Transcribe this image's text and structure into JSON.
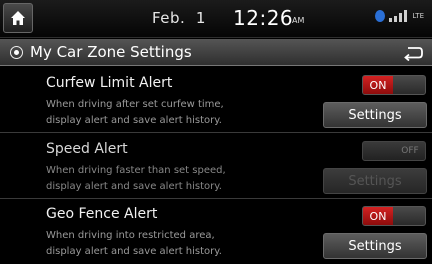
{
  "status_bar": {
    "date": "Feb.  1",
    "time": "12:26",
    "ampm": "AM",
    "network": "LTE",
    "icons": [
      "home-icon",
      "bluetooth-icon",
      "signal-icon"
    ]
  },
  "title_bar": {
    "title": "My Car Zone Settings",
    "icons": [
      "radio-icon",
      "back-icon"
    ]
  },
  "items": [
    {
      "title": "Curfew Limit Alert",
      "desc_line1": "When driving after set curfew time,",
      "desc_line2": "display alert and save alert history.",
      "toggle": "ON",
      "toggle_state": "on",
      "button": "Settings",
      "button_enabled": true
    },
    {
      "title": "Speed Alert",
      "desc_line1": "When driving faster than set speed,",
      "desc_line2": "display alert and save alert history.",
      "toggle": "OFF",
      "toggle_state": "off",
      "button": "Settings",
      "button_enabled": false
    },
    {
      "title": "Geo Fence Alert",
      "desc_line1": "When driving into restricted area,",
      "desc_line2": "display alert and save alert history.",
      "toggle": "ON",
      "toggle_state": "on",
      "button": "Settings",
      "button_enabled": true
    }
  ],
  "colors": {
    "toggle_on": "#d42222",
    "background": "#000000"
  }
}
